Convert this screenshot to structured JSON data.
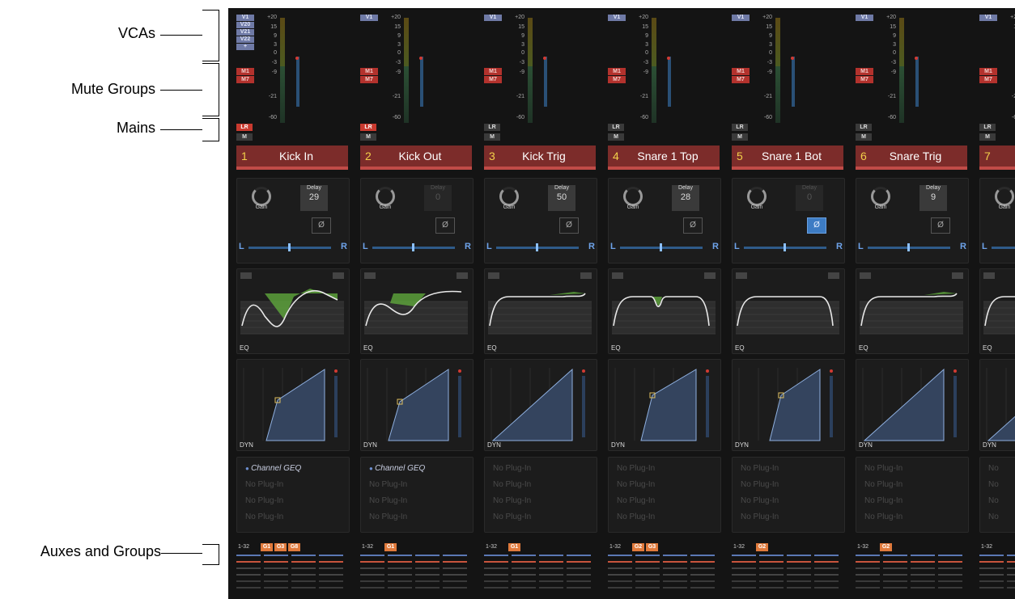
{
  "annotations": {
    "vcas": "VCAs",
    "mute_groups": "Mute Groups",
    "mains": "Mains",
    "auxes_groups": "Auxes and Groups"
  },
  "meter_scale": [
    "+20",
    "15",
    "9",
    "3",
    "0",
    "-3",
    "-9",
    "-21",
    "-60"
  ],
  "labels": {
    "gain": "Gain",
    "delay": "Delay",
    "phase": "Ø",
    "pan_l": "L",
    "pan_r": "R",
    "eq": "EQ",
    "dyn": "DYN",
    "no_plugin": "No Plug-In",
    "aux_range": "1-32",
    "lr": "LR",
    "m": "M"
  },
  "colors": {
    "channel_name_bg": "#7c2c2a",
    "vca": "#6f7aa6",
    "mute": "#b3322d",
    "group_tag": "#e07a3c",
    "eq_fill": "#5fa83c"
  },
  "strips": [
    {
      "num": "1",
      "name": "Kick In",
      "vcas": [
        "V1",
        "V20",
        "V21",
        "V22",
        "+"
      ],
      "mutes": [
        "M1",
        "M7"
      ],
      "lr_on": true,
      "delay": "29",
      "delay_active": true,
      "phase_on": false,
      "plugins": [
        "Channel GEQ",
        "No Plug-In",
        "No Plug-In",
        "No Plug-In"
      ],
      "groups": [
        "G1",
        "G3",
        "G8"
      ]
    },
    {
      "num": "2",
      "name": "Kick Out",
      "vcas": [
        "V1"
      ],
      "mutes": [
        "M1",
        "M7"
      ],
      "lr_on": true,
      "delay": "0",
      "delay_active": false,
      "phase_on": false,
      "plugins": [
        "Channel GEQ",
        "No Plug-In",
        "No Plug-In",
        "No Plug-In"
      ],
      "groups": [
        "G1"
      ]
    },
    {
      "num": "3",
      "name": "Kick Trig",
      "vcas": [
        "V1"
      ],
      "mutes": [
        "M1",
        "M7"
      ],
      "lr_on": false,
      "delay": "50",
      "delay_active": true,
      "phase_on": false,
      "plugins": [
        "No Plug-In",
        "No Plug-In",
        "No Plug-In",
        "No Plug-In"
      ],
      "groups": [
        "G1"
      ]
    },
    {
      "num": "4",
      "name": "Snare 1 Top",
      "vcas": [
        "V1"
      ],
      "mutes": [
        "M1",
        "M7"
      ],
      "lr_on": false,
      "delay": "28",
      "delay_active": true,
      "phase_on": false,
      "plugins": [
        "No Plug-In",
        "No Plug-In",
        "No Plug-In",
        "No Plug-In"
      ],
      "groups": [
        "G2",
        "G3"
      ]
    },
    {
      "num": "5",
      "name": "Snare 1 Bot",
      "vcas": [
        "V1"
      ],
      "mutes": [
        "M1",
        "M7"
      ],
      "lr_on": false,
      "delay": "0",
      "delay_active": false,
      "phase_on": true,
      "plugins": [
        "No Plug-In",
        "No Plug-In",
        "No Plug-In",
        "No Plug-In"
      ],
      "groups": [
        "G2"
      ]
    },
    {
      "num": "6",
      "name": "Snare Trig",
      "vcas": [
        "V1"
      ],
      "mutes": [
        "M1",
        "M7"
      ],
      "lr_on": false,
      "delay": "9",
      "delay_active": true,
      "phase_on": false,
      "plugins": [
        "No Plug-In",
        "No Plug-In",
        "No Plug-In",
        "No Plug-In"
      ],
      "groups": [
        "G2"
      ]
    },
    {
      "num": "7",
      "name": "S",
      "vcas": [
        "V1"
      ],
      "mutes": [
        "M1",
        "M7"
      ],
      "lr_on": false,
      "delay": "",
      "delay_active": true,
      "phase_on": false,
      "plugins": [
        "No",
        "No",
        "No",
        "No"
      ],
      "groups": []
    }
  ]
}
